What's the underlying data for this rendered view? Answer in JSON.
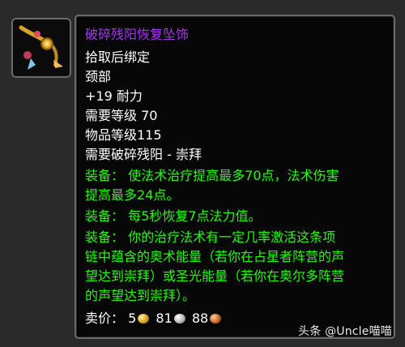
{
  "tooltip": {
    "title": "破碎残阳恢复坠饰",
    "lines": [
      "拾取后绑定",
      "颈部",
      "+19 耐力",
      "需要等级 70",
      "物品等级115",
      "需要破碎残阳 - 崇拜"
    ],
    "equip_lines": [
      "装备：  使法术治疗提高最多70点，法术伤害",
      "提高最多24点。",
      "装备：  每5秒恢复7点法力值。",
      "装备：  你的治疗法术有一定几率激活这条项",
      "链中蕴含的奥术能量（若你在占星者阵营的声",
      "望达到崇拜）或圣光能量（若你在奥尔多阵营",
      "的声望达到崇拜）。"
    ],
    "sell_price": {
      "label": "卖价：",
      "gold": "5",
      "silver": "81",
      "copper": "88"
    }
  },
  "colors": {
    "title": "#a335ee",
    "equip": "#1eff00",
    "text": "#ffffff"
  },
  "icon": {
    "name": "amulet-icon"
  },
  "watermark": "头条 @Uncle喵喵"
}
